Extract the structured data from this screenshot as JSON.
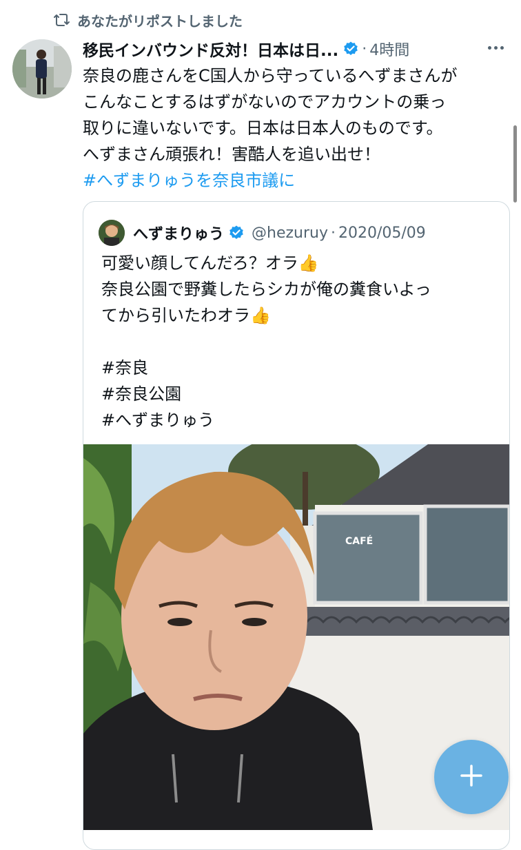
{
  "repost": {
    "text": "あなたがリポストしました",
    "icon": "repost-icon"
  },
  "tweet": {
    "author_name": "移民インバウンド反対！日本は日...",
    "verified_icon": "verified-badge-icon",
    "separator": "·",
    "time": "4時間",
    "more_icon": "more-icon",
    "text_lines": [
      "奈良の鹿さんをC国人から守っているへずまさんが",
      "こんなことするはずがないのでアカウントの乗っ",
      "取りに違いないです。日本は日本人のものです。",
      "へずまさん頑張れ！害酷人を追い出せ！"
    ],
    "hashtag": "#へずまりゅうを奈良市議に"
  },
  "quote": {
    "author_name": "へずまりゅう",
    "verified_icon": "verified-badge-icon",
    "handle": "@hezuruy",
    "separator": "·",
    "date": "2020/05/09",
    "text_lines": [
      "可愛い顔してんだろ？オラ👍",
      "奈良公園で野糞したらシカが俺の糞食いよっ",
      "てから引いたわオラ👍",
      "",
      "#奈良",
      "#奈良公園",
      "#へずまりゅう"
    ],
    "photo": {
      "cafe_sign": "CAFÉ"
    }
  },
  "fab": {
    "label": "+",
    "color": "#5eace2"
  },
  "colors": {
    "link": "#1d9bf0",
    "secondary_text": "#536471",
    "verified": "#1d9bf0"
  }
}
